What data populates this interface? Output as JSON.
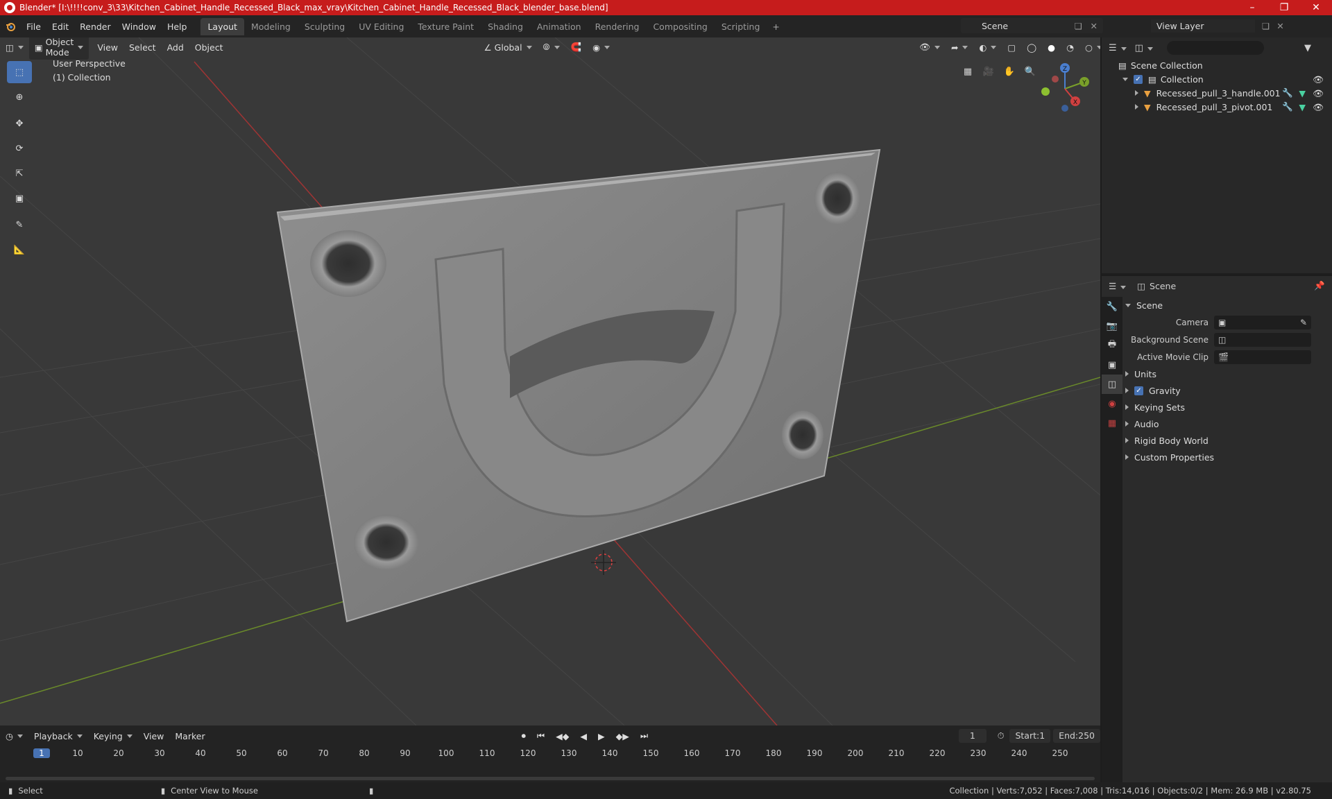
{
  "window": {
    "title": "Blender* [I:\\!!!!conv_3\\33\\Kitchen_Cabinet_Handle_Recessed_Black_max_vray\\Kitchen_Cabinet_Handle_Recessed_Black_blender_base.blend]"
  },
  "menu": [
    "File",
    "Edit",
    "Render",
    "Window",
    "Help"
  ],
  "workspaces": [
    "Layout",
    "Modeling",
    "Sculpting",
    "UV Editing",
    "Texture Paint",
    "Shading",
    "Animation",
    "Rendering",
    "Compositing",
    "Scripting"
  ],
  "active_workspace": "Layout",
  "scene_name": "Scene",
  "view_layer": "View Layer",
  "viewport": {
    "mode": "Object Mode",
    "menus": [
      "View",
      "Select",
      "Add",
      "Object"
    ],
    "orientation": "Global",
    "info_line1": "User Perspective",
    "info_line2": "(1) Collection",
    "gizmo": {
      "x": "X",
      "y": "Y",
      "z": "Z"
    }
  },
  "outliner": {
    "root": "Scene Collection",
    "collection": "Collection",
    "objects": [
      "Recessed_pull_3_handle.001",
      "Recessed_pull_3_pivot.001"
    ]
  },
  "properties": {
    "header": "Scene",
    "panel": "Scene",
    "rows": [
      {
        "label": "Camera"
      },
      {
        "label": "Background Scene"
      },
      {
        "label": "Active Movie Clip"
      }
    ],
    "sections": [
      "Units",
      "Gravity",
      "Keying Sets",
      "Audio",
      "Rigid Body World",
      "Custom Properties"
    ]
  },
  "timeline": {
    "menus": [
      "Playback",
      "Keying",
      "View",
      "Marker"
    ],
    "current_frame": "1",
    "start_label": "Start:",
    "start": "1",
    "end_label": "End:",
    "end": "250",
    "ticks": [
      "1",
      "10",
      "20",
      "30",
      "40",
      "50",
      "60",
      "70",
      "80",
      "90",
      "100",
      "110",
      "120",
      "130",
      "140",
      "150",
      "160",
      "170",
      "180",
      "190",
      "200",
      "210",
      "220",
      "230",
      "240",
      "250"
    ]
  },
  "status": {
    "select": "Select",
    "center": "Center View to Mouse",
    "stats": "Collection | Verts:7,052 | Faces:7,008 | Tris:14,016 | Objects:0/2 | Mem: 26.9 MB | v2.80.75"
  },
  "colors": {
    "accent": "#4772b3",
    "titlebar": "#c61c1c",
    "object_orange": "#e8a040"
  }
}
